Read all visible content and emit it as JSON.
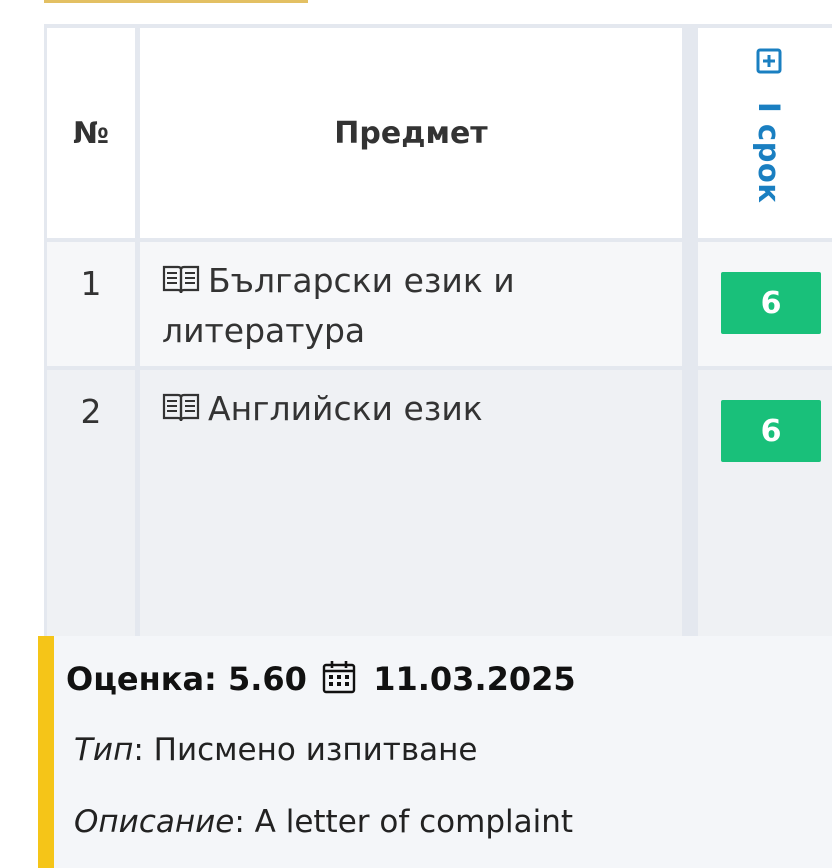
{
  "table": {
    "headers": {
      "number": "№",
      "subject": "Предмет",
      "term": "I срок"
    },
    "rows": [
      {
        "number": "1",
        "subject": "Български език и литература",
        "grade": "6"
      },
      {
        "number": "2",
        "subject": "Английски език",
        "grade": "6"
      }
    ]
  },
  "popup": {
    "grade_label": "Оценка:",
    "grade_value": "5.60",
    "date": "11.03.2025",
    "type_label": "Тип",
    "type_value": "Писмено изпитване",
    "description_label": "Описание",
    "description_value": "A letter of complaint"
  },
  "colors": {
    "grade_badge": "#19c07a",
    "term_link": "#1a7fc1",
    "popup_accent": "#f5c518"
  },
  "icons": {
    "expand": "plus-square-icon",
    "subject": "book-icon",
    "date": "calendar-icon"
  }
}
